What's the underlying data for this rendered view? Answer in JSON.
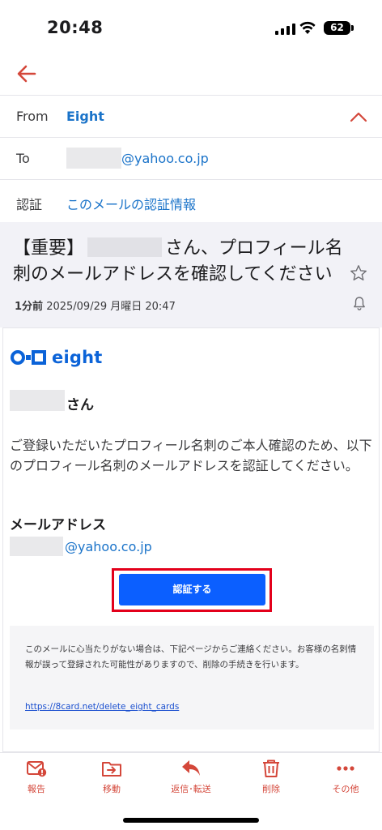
{
  "status_bar": {
    "time": "20:48",
    "battery": "62"
  },
  "header": {
    "from_label": "From",
    "from_value": "Eight",
    "to_label": "To",
    "to_domain": "@yahoo.co.jp",
    "auth_label": "認証",
    "auth_value": "このメールの認証情報"
  },
  "subject": {
    "prefix": "【重要】",
    "line1_suffix": "さん、プロフィール名",
    "line2": "刺のメールアドレスを確認してください",
    "meta_relative": "1分前",
    "meta_datetime": "2025/09/29 月曜日 20:47"
  },
  "body": {
    "brand_name": "eight",
    "greeting_suffix": "さん",
    "paragraph": "ご登録いただいたプロフィール名刺のご本人確認のため、以下のプロフィール名刺のメールアドレスを認証してください。",
    "email_label": "メールアドレス",
    "email_domain": "@yahoo.co.jp",
    "verify_button": "認証する",
    "notice": "このメールに心当たりがない場合は、下記ページからご連絡ください。お客様の名刺情報が誤って登録された可能性がありますので、削除の手続きを行います。",
    "notice_link": "https://8card.net/delete_eight_cards"
  },
  "toolbar": {
    "report": "報告",
    "move": "移動",
    "reply": "返信･転送",
    "delete": "削除",
    "more": "その他"
  },
  "colors": {
    "accent_red": "#d4473a",
    "link_blue": "#1a73c9",
    "button_blue": "#0b5fff",
    "highlight_red": "#e3001b"
  },
  "icons": [
    "back-arrow-icon",
    "chevron-up-icon",
    "star-icon",
    "bell-icon",
    "eight-logo-icon",
    "report-icon",
    "move-icon",
    "reply-icon",
    "trash-icon",
    "more-icon"
  ]
}
